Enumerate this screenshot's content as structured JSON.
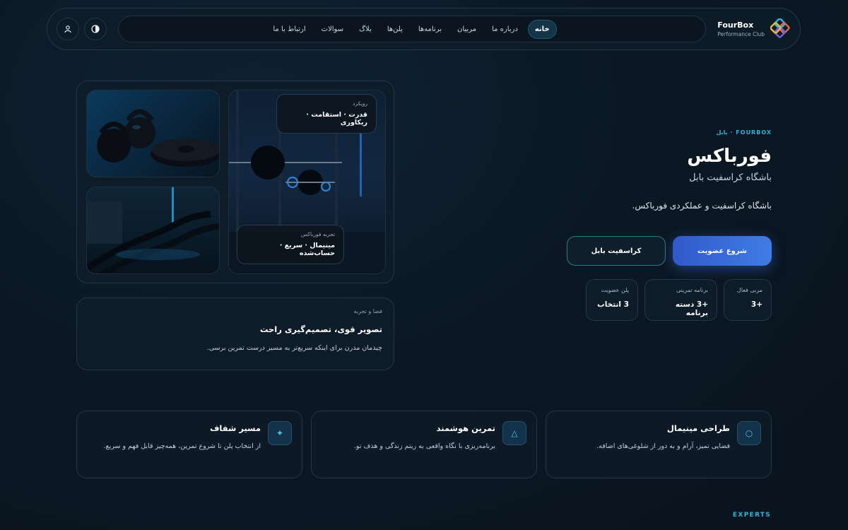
{
  "header": {
    "brand_name": "FourBox",
    "brand_sub": "Performance Club",
    "nav": [
      {
        "label": "خانه",
        "active": true
      },
      {
        "label": "درباره ما",
        "active": false
      },
      {
        "label": "مربیان",
        "active": false
      },
      {
        "label": "برنامه‌ها",
        "active": false
      },
      {
        "label": "پلن‌ها",
        "active": false
      },
      {
        "label": "بلاگ",
        "active": false
      },
      {
        "label": "سوالات",
        "active": false
      },
      {
        "label": "ارتباط با ما",
        "active": false
      }
    ],
    "icons": [
      "theme-toggle-icon",
      "user-icon"
    ]
  },
  "gallery": {
    "overlay_approach": {
      "label": "رویکرد",
      "title": "قدرت · استقامت · ریکاوری"
    },
    "overlay_experience": {
      "label": "تجربه فورباکس",
      "title": "مینیمال · سریع · حساب‌شده"
    }
  },
  "experience_card": {
    "label": "فضا و تجربه",
    "title": "تصویر قوی، تصمیم‌گیری راحت",
    "desc": "چیدمان مدرن برای اینکه سریع‌تر به مسیر درست تمرین برسی."
  },
  "hero": {
    "eyebrow": "FOURBOX · بابل",
    "title": "فورباکس",
    "subtitle": "باشگاه کراسفیت بابل",
    "desc": "باشگاه کراسفیت و عملکردی فورباکس.",
    "primary_cta": "شروع عضویت",
    "secondary_cta": "کراسفیت بابل"
  },
  "stats": [
    {
      "label": "مربی فعال",
      "value": "+3"
    },
    {
      "label": "برنامه تمرینی",
      "value": "+3 دسته برنامه"
    },
    {
      "label": "پلن عضویت",
      "value": "3 انتخاب"
    }
  ],
  "features": [
    {
      "icon": "circle-icon",
      "glyph": "○",
      "title": "طراحی مینیمال",
      "desc": "فضایی تمیز، آرام و به دور از شلوغی‌های اضافه."
    },
    {
      "icon": "triangle-icon",
      "glyph": "△",
      "title": "تمرین هوشمند",
      "desc": "برنامه‌ریزی با نگاه واقعی به ریتم زندگی و هدف تو."
    },
    {
      "icon": "sparkle-icon",
      "glyph": "✦",
      "title": "مسیر شفاف",
      "desc": "از انتخاب پلن تا شروع تمرین، همه‌چیز قابل فهم و سریع."
    }
  ],
  "section_label": "EXPERTS",
  "colors": {
    "accent": "#2bb4d8",
    "primary": "#3f7ce4",
    "background": "#0b1824"
  }
}
